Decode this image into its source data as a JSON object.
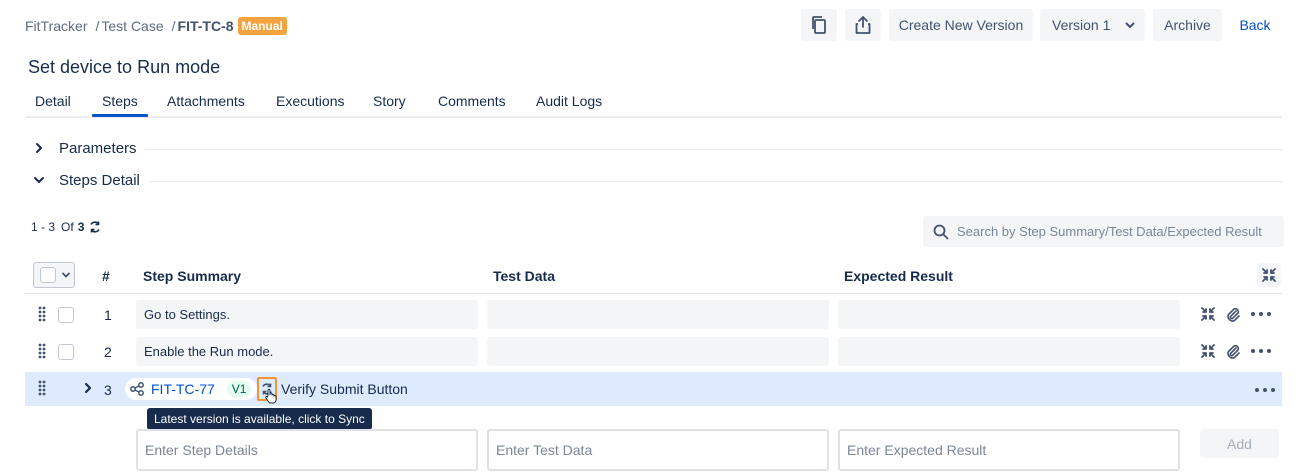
{
  "breadcrumb": {
    "project": "FitTracker",
    "section": "Test Case",
    "current": "FIT-TC-8",
    "type_badge": "Manual"
  },
  "toolbar": {
    "copy_icon": "copy-icon",
    "share_icon": "share-icon",
    "create_version_label": "Create New Version",
    "version_selected": "Version 1",
    "archive_label": "Archive",
    "back_label": "Back"
  },
  "page_title": "Set device to Run mode",
  "tabs": [
    {
      "label": "Detail"
    },
    {
      "label": "Steps"
    },
    {
      "label": "Attachments"
    },
    {
      "label": "Executions"
    },
    {
      "label": "Story"
    },
    {
      "label": "Comments"
    },
    {
      "label": "Audit Logs"
    }
  ],
  "active_tab": "Steps",
  "sections": {
    "parameters": "Parameters",
    "steps_detail": "Steps Detail"
  },
  "pager": {
    "range": "1 - 3",
    "of": "Of",
    "total": "3"
  },
  "search": {
    "placeholder": "Search by Step Summary/Test Data/Expected Result"
  },
  "table": {
    "columns": {
      "number": "#",
      "step_summary": "Step Summary",
      "test_data": "Test Data",
      "expected_result": "Expected Result"
    },
    "rows": [
      {
        "number": "1",
        "step_summary": "Go to Settings.",
        "test_data": "",
        "expected_result": ""
      },
      {
        "number": "2",
        "step_summary": "Enable the Run mode.",
        "test_data": "",
        "expected_result": ""
      }
    ],
    "linked_row": {
      "number": "3",
      "link_id": "FIT-TC-77",
      "version": "V1",
      "title": "Verify Submit Button"
    }
  },
  "tooltip": "Latest version is available, click to Sync",
  "new_step": {
    "step_placeholder": "Enter Step Details",
    "data_placeholder": "Enter Test Data",
    "result_placeholder": "Enter Expected Result",
    "add_label": "Add"
  },
  "colors": {
    "accent": "#0052cc",
    "manual_badge": "#f4a340",
    "linked_row_bg": "#deebff",
    "sync_highlight": "#f79233",
    "tooltip_bg": "#172b4d"
  }
}
